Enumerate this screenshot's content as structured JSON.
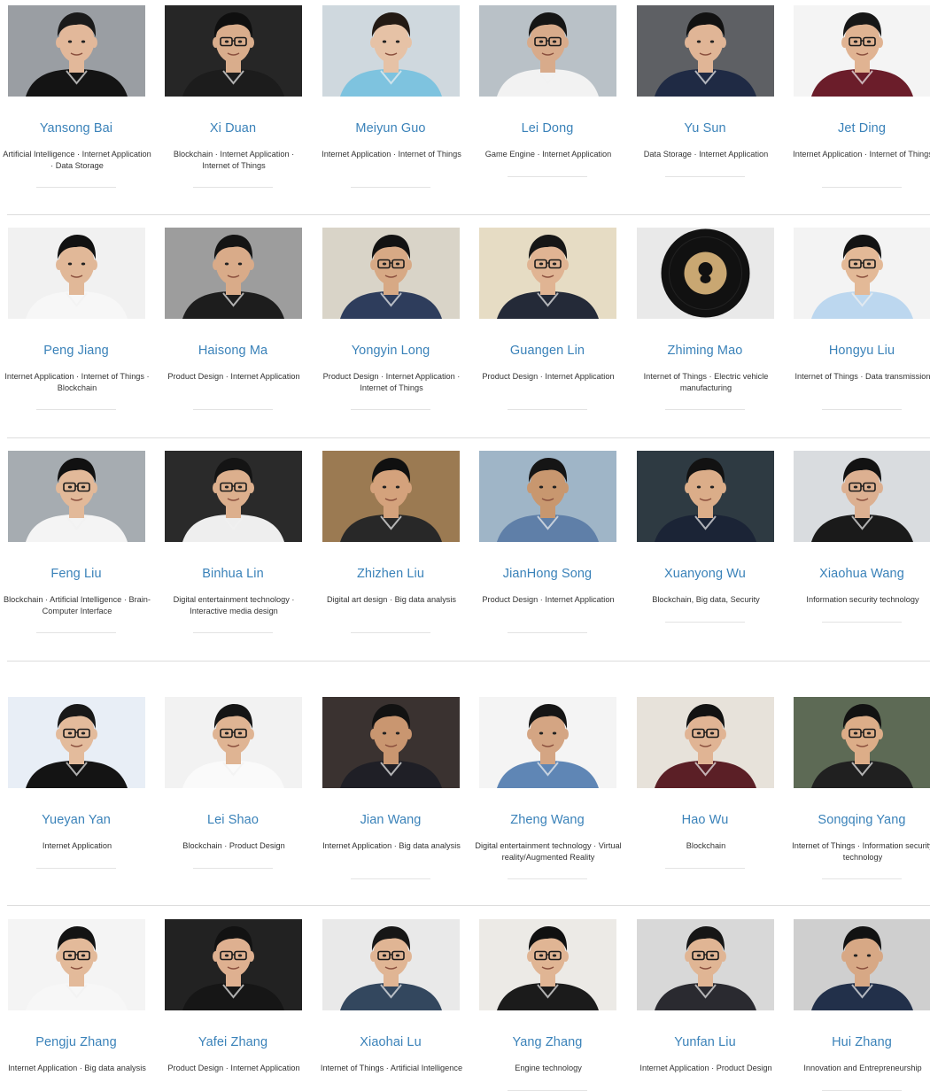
{
  "people": [
    [
      {
        "name": "Yansong Bai",
        "tags": "Artificial Intelligence · Internet Application · Data Storage",
        "photo": {
          "bg": "#9a9ea3",
          "skin": "#e2b89a",
          "hair": "#1a1a1a",
          "shirt": "#141414",
          "glasses": false
        }
      },
      {
        "name": "Xi Duan",
        "tags": "Blockchain · Internet Application · Internet of Things",
        "photo": {
          "bg": "#262626",
          "skin": "#d9ad8c",
          "hair": "#0f0f0f",
          "shirt": "#1c1c1c",
          "glasses": true
        }
      },
      {
        "name": "Meiyun Guo",
        "tags": "Internet Application · Internet of Things",
        "photo": {
          "bg": "#cfd8de",
          "skin": "#e6c2a6",
          "hair": "#231a14",
          "shirt": "#7ec3df",
          "glasses": false
        }
      },
      {
        "name": "Lei Dong",
        "tags": "Game Engine · Internet Application",
        "photo": {
          "bg": "#b9c1c7",
          "skin": "#d8ab8b",
          "hair": "#151515",
          "shirt": "#f2f2f2",
          "glasses": true
        }
      },
      {
        "name": "Yu Sun",
        "tags": "Data Storage · Internet Application",
        "photo": {
          "bg": "#5e6064",
          "skin": "#e0b596",
          "hair": "#121212",
          "shirt": "#1f2a44",
          "glasses": false
        }
      },
      {
        "name": "Jet Ding",
        "tags": "Internet Application · Internet of Things",
        "photo": {
          "bg": "#f4f4f4",
          "skin": "#e0b392",
          "hair": "#171717",
          "shirt": "#6b1d2a",
          "glasses": true
        }
      }
    ],
    [
      {
        "name": "Peng Jiang",
        "tags": "Internet Application · Internet of Things · Blockchain",
        "photo": {
          "bg": "#f1f1f1",
          "skin": "#e1b898",
          "hair": "#111111",
          "shirt": "#f7f7f7",
          "glasses": false
        }
      },
      {
        "name": "Haisong Ma",
        "tags": "Product Design · Internet Application",
        "photo": {
          "bg": "#9d9d9d",
          "skin": "#d9ab89",
          "hair": "#141414",
          "shirt": "#1d1d1d",
          "glasses": false
        }
      },
      {
        "name": "Yongyin Long",
        "tags": "Product Design · Internet Application · Internet of Things",
        "photo": {
          "bg": "#d9d4c8",
          "skin": "#d7a985",
          "hair": "#121212",
          "shirt": "#2e3d5c",
          "glasses": true
        }
      },
      {
        "name": "Guangen Lin",
        "tags": "Product Design · Internet Application",
        "photo": {
          "bg": "#e6dcc4",
          "skin": "#e0b493",
          "hair": "#161616",
          "shirt": "#242a38",
          "glasses": true
        }
      },
      {
        "name": "Zhiming Mao",
        "tags": "Internet of Things · Electric vehicle manufacturing",
        "photo": {
          "bg": "#e9e9e9",
          "record": true
        }
      },
      {
        "name": "Hongyu Liu",
        "tags": "Internet of Things · Data transmission",
        "photo": {
          "bg": "#f3f3f3",
          "skin": "#e3b997",
          "hair": "#131313",
          "shirt": "#bcd7ef",
          "glasses": true
        }
      }
    ],
    [
      {
        "name": "Feng Liu",
        "tags": "Blockchain · Artificial Intelligence · Brain-Computer Interface",
        "photo": {
          "bg": "#a6acb1",
          "skin": "#e2b999",
          "hair": "#111111",
          "shirt": "#f4f4f4",
          "glasses": true
        }
      },
      {
        "name": "Binhua Lin",
        "tags": "Digital entertainment technology · Interactive media design",
        "photo": {
          "bg": "#2a2a2a",
          "skin": "#dcaf8d",
          "hair": "#141414",
          "shirt": "#eeeeee",
          "glasses": true
        }
      },
      {
        "name": "Zhizhen Liu",
        "tags": "Digital art design · Big data analysis",
        "photo": {
          "bg": "#9b7a52",
          "skin": "#d4a27c",
          "hair": "#101010",
          "shirt": "#282828",
          "glasses": false
        }
      },
      {
        "name": "JianHong Song",
        "tags": "Product Design · Internet Application",
        "photo": {
          "bg": "#9fb5c7",
          "skin": "#c8976f",
          "hair": "#151515",
          "shirt": "#5f7fa8",
          "glasses": false
        }
      },
      {
        "name": "Xuanyong Wu",
        "tags": "Blockchain, Big data, Security",
        "photo": {
          "bg": "#2e3a42",
          "skin": "#dbad89",
          "hair": "#121212",
          "shirt": "#1b2436",
          "glasses": false
        }
      },
      {
        "name": "Xiaohua Wang",
        "tags": "Information security technology",
        "photo": {
          "bg": "#d9dcdf",
          "skin": "#dcb091",
          "hair": "#121212",
          "shirt": "#1a1a1a",
          "glasses": true
        }
      }
    ],
    [
      {
        "name": "Yueyan Yan",
        "tags": "Internet Application",
        "photo": {
          "bg": "#e8eef6",
          "skin": "#e3bb9c",
          "hair": "#181818",
          "shirt": "#141414",
          "glasses": true
        }
      },
      {
        "name": "Lei Shao",
        "tags": "Blockchain · Product Design",
        "photo": {
          "bg": "#f2f2f2",
          "skin": "#dfb493",
          "hair": "#151515",
          "shirt": "#fafafa",
          "glasses": true
        }
      },
      {
        "name": "Jian Wang",
        "tags": "Internet Application · Big data analysis",
        "photo": {
          "bg": "#3a3230",
          "skin": "#c99670",
          "hair": "#121212",
          "shirt": "#1f1f26",
          "glasses": false
        }
      },
      {
        "name": "Zheng Wang",
        "tags": "Digital entertainment technology · Virtual reality/Augmented Reality",
        "photo": {
          "bg": "#f4f4f4",
          "skin": "#d4a583",
          "hair": "#151515",
          "shirt": "#5f86b5",
          "glasses": false
        }
      },
      {
        "name": "Hao Wu",
        "tags": "Blockchain",
        "photo": {
          "bg": "#e7e2da",
          "skin": "#e0b494",
          "hair": "#121212",
          "shirt": "#5b1f26",
          "glasses": true
        }
      },
      {
        "name": "Songqing Yang",
        "tags": "Internet of Things · Information security technology",
        "photo": {
          "bg": "#5d6a55",
          "skin": "#dcad88",
          "hair": "#121212",
          "shirt": "#202020",
          "glasses": true
        }
      }
    ],
    [
      {
        "name": "Pengju Zhang",
        "tags": "Internet Application · Big data analysis",
        "photo": {
          "bg": "#f4f4f4",
          "skin": "#e3ba9a",
          "hair": "#131313",
          "shirt": "#f7f7f7",
          "glasses": true
        }
      },
      {
        "name": "Yafei Zhang",
        "tags": "Product Design · Internet Application",
        "photo": {
          "bg": "#222222",
          "skin": "#deb090",
          "hair": "#121212",
          "shirt": "#161616",
          "glasses": true
        }
      },
      {
        "name": "Xiaohai Lu",
        "tags": "Internet of Things · Artificial Intelligence",
        "photo": {
          "bg": "#e9e9e9",
          "skin": "#e0b594",
          "hair": "#161616",
          "shirt": "#33475e",
          "glasses": true
        }
      },
      {
        "name": "Yang Zhang",
        "tags": "Engine technology",
        "photo": {
          "bg": "#eceae6",
          "skin": "#e0b594",
          "hair": "#101010",
          "shirt": "#1b1b1b",
          "glasses": true
        }
      },
      {
        "name": "Yunfan Liu",
        "tags": "Internet Application · Product Design",
        "photo": {
          "bg": "#d8d8d8",
          "skin": "#e0b594",
          "hair": "#161616",
          "shirt": "#2a2a30",
          "glasses": true
        }
      },
      {
        "name": "Hui Zhang",
        "tags": "Innovation and Entrepreneurship",
        "photo": {
          "bg": "#cfcfcf",
          "skin": "#d7a885",
          "hair": "#121212",
          "shirt": "#22304a",
          "glasses": false
        }
      }
    ]
  ]
}
